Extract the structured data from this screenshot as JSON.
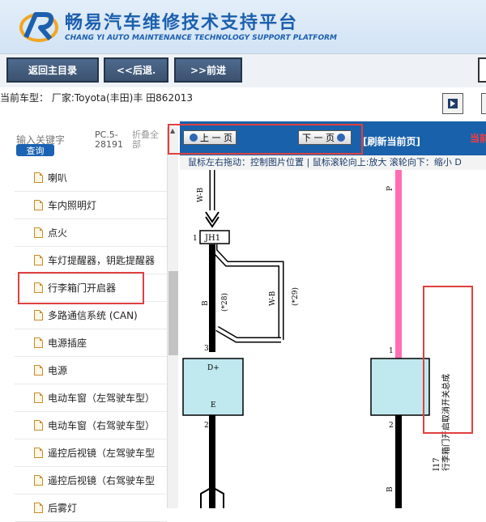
{
  "header": {
    "title": "畅易汽车维修技术支持平台",
    "subtitle": "CHANG YI AUTO MAINTENANCE TECHNOLOGY SUPPORT PLATFORM"
  },
  "toolbar": {
    "home_label": "返回主目录",
    "back_label": "<<后退.",
    "forward_label": ">>前进"
  },
  "vehicle_info": "当前车型：  厂家:Toyota(丰田)丰 田862013",
  "sidebar": {
    "search_placeholder": "输入关键字",
    "search_button": "查询",
    "pc_label": "PC.5-28191",
    "collapse_label": "折叠全部",
    "items": [
      {
        "label": "喇叭"
      },
      {
        "label": "车内照明灯"
      },
      {
        "label": "点火"
      },
      {
        "label": "车灯提醒器，钥匙提醒器"
      },
      {
        "label": "行李箱门开启器"
      },
      {
        "label": "多路通信系统 (CAN)"
      },
      {
        "label": "电源插座"
      },
      {
        "label": "电源"
      },
      {
        "label": "电动车窗（左驾驶车型）"
      },
      {
        "label": "电动车窗（右驾驶车型）"
      },
      {
        "label": "遥控后视镜（左驾驶车型"
      },
      {
        "label": "遥控后视镜（右驾驶车型"
      },
      {
        "label": "后雾灯"
      }
    ]
  },
  "viewer": {
    "prev_page": "上 一 页",
    "next_page": "下 一 页",
    "refresh": "[刷新当前页]",
    "current_label": "当前",
    "hint": "鼠标左右拖动：控制图片位置 | 鼠标滚轮向上:放大  滚轮向下：缩小  D",
    "diagram": {
      "wire_wb_top": "W-B",
      "connector_jh1": "JH1",
      "pin_1_left": "1",
      "wire_b_left": "B",
      "tag_28": "(*28)",
      "wire_wb_mid": "W-B",
      "tag_29": "(*29)",
      "pin_3": "3",
      "block_left_dplus": "D+",
      "block_left_e": "E",
      "pin_2_left": "2",
      "wire_p": "P",
      "pin_1_right": "1",
      "pin_2_right": "2",
      "wire_b_right": "B",
      "component_id": "I17",
      "component_name": "行李箱门开启取消开关总成"
    }
  },
  "colors": {
    "brand_blue": "#1c5fae",
    "viewer_bar": "#1961aa",
    "highlight_red": "#e04040",
    "wire_pink": "#ff6eb4",
    "block_cyan": "#bfe9ef"
  }
}
